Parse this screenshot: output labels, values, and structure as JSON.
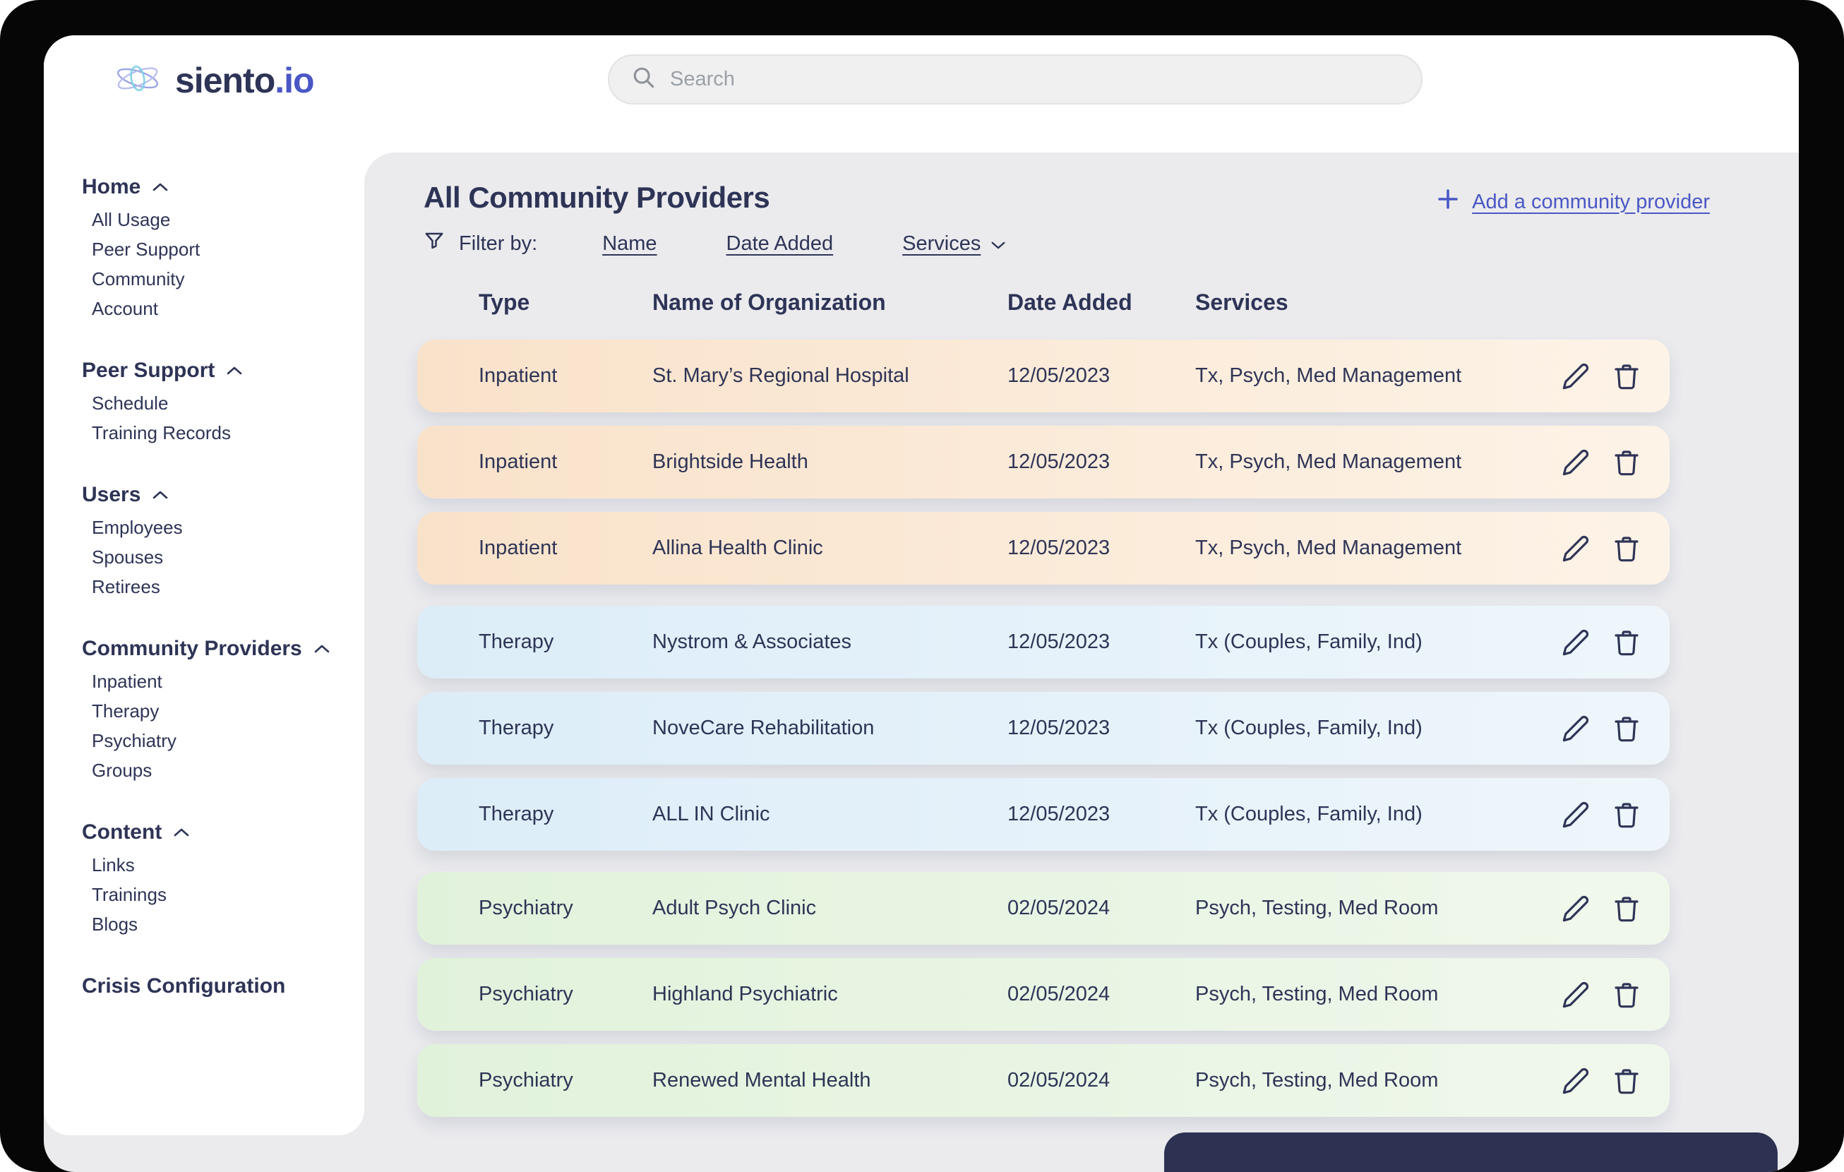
{
  "brand": {
    "name": "siento",
    "suffix": ".io"
  },
  "search": {
    "placeholder": "Search"
  },
  "sidebar": {
    "sections": [
      {
        "label": "Home",
        "expanded": true,
        "items": [
          "All Usage",
          "Peer Support",
          "Community",
          "Account"
        ]
      },
      {
        "label": "Peer Support",
        "expanded": true,
        "items": [
          "Schedule",
          "Training Records"
        ]
      },
      {
        "label": "Users",
        "expanded": true,
        "items": [
          "Employees",
          "Spouses",
          "Retirees"
        ]
      },
      {
        "label": "Community Providers",
        "expanded": true,
        "active": true,
        "items": [
          "Inpatient",
          "Therapy",
          "Psychiatry",
          "Groups"
        ]
      },
      {
        "label": "Content",
        "expanded": true,
        "items": [
          "Links",
          "Trainings",
          "Blogs"
        ]
      },
      {
        "label": "Crisis Configuration",
        "expanded": null,
        "items": []
      }
    ]
  },
  "main": {
    "title": "All Community Providers",
    "add_provider": {
      "label": "Add a community provider"
    },
    "filter": {
      "label": "Filter by:",
      "name": "Name",
      "date_added": "Date Added",
      "services": "Services"
    },
    "table": {
      "headers": {
        "type": "Type",
        "name": "Name of Organization",
        "date": "Date Added",
        "services": "Services"
      },
      "rows": [
        {
          "type": "Inpatient",
          "name": "St. Mary’s Regional Hospital",
          "date": "12/05/2023",
          "services": "Tx, Psych, Med Management",
          "group": "inpatient"
        },
        {
          "type": "Inpatient",
          "name": "Brightside Health",
          "date": "12/05/2023",
          "services": "Tx, Psych, Med Management",
          "group": "inpatient"
        },
        {
          "type": "Inpatient",
          "name": "Allina Health Clinic",
          "date": "12/05/2023",
          "services": "Tx, Psych, Med Management",
          "group": "inpatient"
        },
        {
          "type": "Therapy",
          "name": "Nystrom & Associates",
          "date": "12/05/2023",
          "services": "Tx (Couples, Family, Ind)",
          "group": "therapy"
        },
        {
          "type": "Therapy",
          "name": "NoveCare Rehabilitation",
          "date": "12/05/2023",
          "services": "Tx (Couples, Family, Ind)",
          "group": "therapy"
        },
        {
          "type": "Therapy",
          "name": "ALL IN Clinic",
          "date": "12/05/2023",
          "services": "Tx (Couples, Family, Ind)",
          "group": "therapy"
        },
        {
          "type": "Psychiatry",
          "name": "Adult Psych Clinic",
          "date": "02/05/2024",
          "services": "Psych, Testing, Med Room",
          "group": "psychiatry"
        },
        {
          "type": "Psychiatry",
          "name": "Highland Psychiatric",
          "date": "02/05/2024",
          "services": "Psych, Testing, Med Room",
          "group": "psychiatry"
        },
        {
          "type": "Psychiatry",
          "name": "Renewed Mental Health",
          "date": "02/05/2024",
          "services": "Psych, Testing, Med Room",
          "group": "psychiatry"
        }
      ]
    }
  },
  "colors": {
    "text_navy": "#2e3456",
    "accent_link": "#4a57c5",
    "row_inpatient": "#f9e2ca",
    "row_therapy": "#dcedf8",
    "row_psychiatry": "#e1f2db",
    "background": "#ebebee",
    "panel": "#ffffff"
  }
}
